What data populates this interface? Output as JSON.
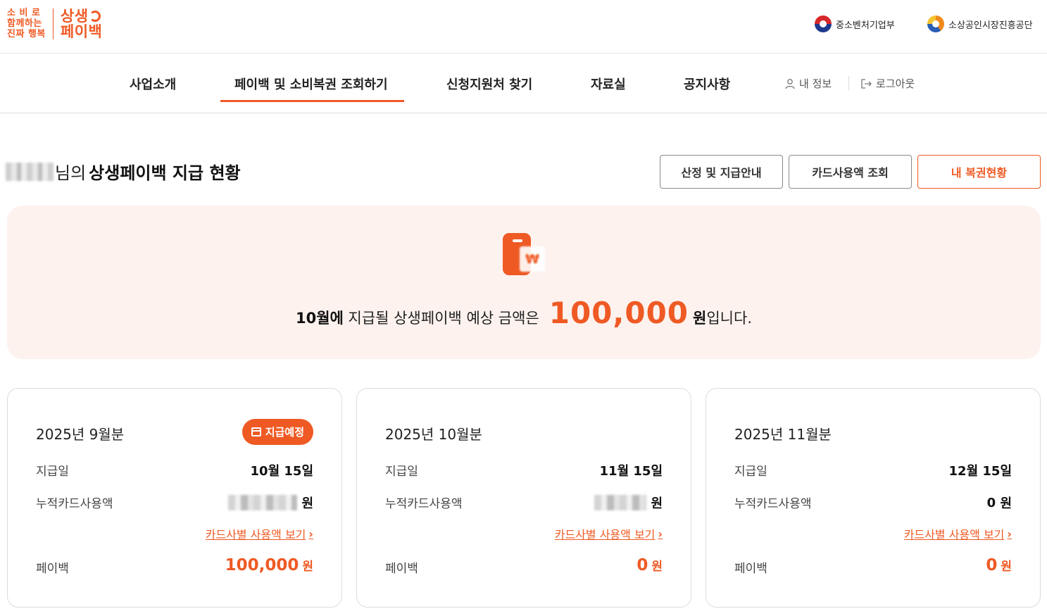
{
  "header": {
    "slogan": [
      "소 비 로",
      "함께하는",
      "진짜 행복"
    ],
    "brand": [
      "상생",
      "페이백"
    ],
    "ministry_1": "중소벤처기업부",
    "ministry_2": "소상공인시장진흥공단"
  },
  "nav": {
    "items": [
      "사업소개",
      "페이백 및 소비복권 조회하기",
      "신청지원처 찾기",
      "자료실",
      "공지사항"
    ],
    "active_index": 1,
    "my_info": "내 정보",
    "logout": "로그아웃"
  },
  "title": {
    "suffix": "님의",
    "main": "상생페이백 지급 현황"
  },
  "actions": {
    "guide": "산정 및 지급안내",
    "card_usage": "카드사용액 조회",
    "my_lottery": "내 복권현황"
  },
  "hero": {
    "icon": "wallet-won-icon",
    "month_strong": "10월에",
    "text_mid": "지급될 상생페이백 예상 금액은",
    "amount": "100,000",
    "unit_strong": "원",
    "text_end": "입니다."
  },
  "cards": [
    {
      "title": "2025년 9월분",
      "badge": "지급예정",
      "pay_date_label": "지급일",
      "pay_date": "10월 15일",
      "usage_label": "누적카드사용액",
      "usage_unit": "원",
      "link": "카드사별 사용액 보기",
      "payback_label": "페이백",
      "payback": "100,000",
      "payback_unit": "원"
    },
    {
      "title": "2025년 10월분",
      "pay_date_label": "지급일",
      "pay_date": "11월 15일",
      "usage_label": "누적카드사용액",
      "usage_unit": "원",
      "link": "카드사별 사용액 보기",
      "payback_label": "페이백",
      "payback": "0",
      "payback_unit": "원"
    },
    {
      "title": "2025년 11월분",
      "pay_date_label": "지급일",
      "pay_date": "12월 15일",
      "usage_label": "누적카드사용액",
      "usage_value": "0",
      "usage_unit": "원",
      "link": "카드사별 사용액 보기",
      "payback_label": "페이백",
      "payback": "0",
      "payback_unit": "원"
    }
  ],
  "colors": {
    "accent": "#ef5a24",
    "hero_bg": "#fdf2ee"
  }
}
